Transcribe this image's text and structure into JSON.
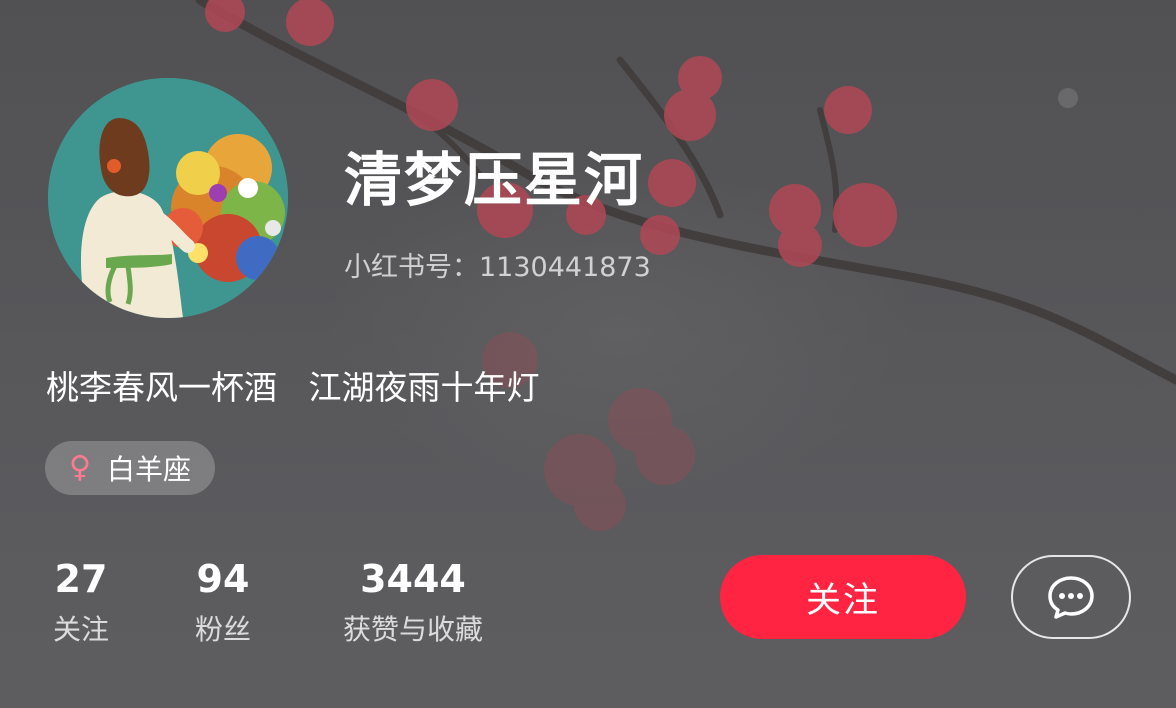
{
  "profile": {
    "nickname": "清梦压星河",
    "red_id": "小红书号：1130441873",
    "bio": "桃李春风一杯酒   江湖夜雨十年灯",
    "tag": {
      "gender_icon": "female-icon",
      "label": "白羊座"
    }
  },
  "stats": [
    {
      "value": "27",
      "label": "关注"
    },
    {
      "value": "94",
      "label": "粉丝"
    },
    {
      "value": "3444",
      "label": "获赞与收藏"
    }
  ],
  "actions": {
    "follow_label": "关注",
    "message_icon": "chat-bubble-icon"
  },
  "colors": {
    "accent": "#ff2442",
    "female_icon": "#ff7a90"
  }
}
